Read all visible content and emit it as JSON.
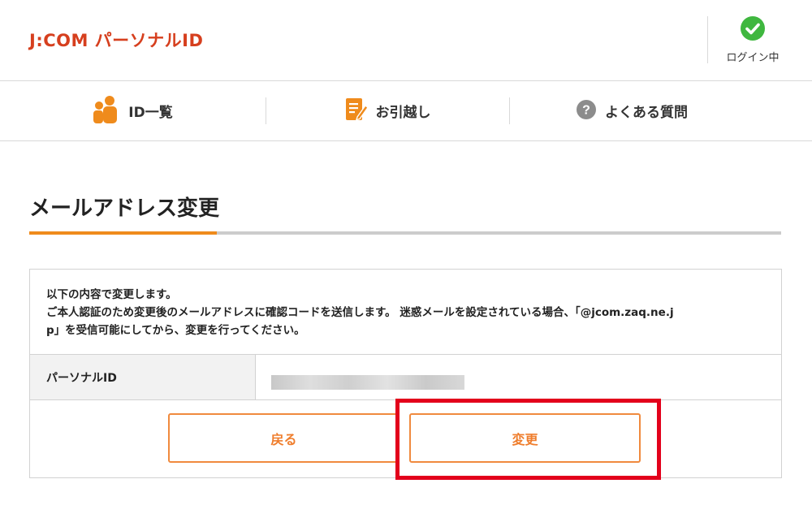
{
  "header": {
    "logo_text": "J:COM パーソナルID",
    "login_status": "ログイン中",
    "login_icon": "check-circle-icon"
  },
  "nav": {
    "items": [
      {
        "label": "ID一覧",
        "icon": "users-icon"
      },
      {
        "label": "お引越し",
        "icon": "edit-note-icon"
      },
      {
        "label": "よくある質問",
        "icon": "question-circle-icon"
      }
    ]
  },
  "page": {
    "title": "メールアドレス変更"
  },
  "form": {
    "description_lines": [
      "以下の内容で変更します。",
      "ご本人認証のため変更後のメールアドレスに確認コードを送信します。 迷惑メールを設定されている場合、「@jcom.zaq.ne.j",
      "p」を受信可能にしてから、変更を行ってください。"
    ],
    "row_label": "パーソナルID",
    "row_value": "",
    "back_label": "戻る",
    "submit_label": "変更"
  },
  "colors": {
    "brand": "#d63f1e",
    "accent_orange": "#ef8b1c",
    "button_text": "#ef7d2c",
    "highlight_red": "#e3001b",
    "login_green": "#3fb73f"
  }
}
